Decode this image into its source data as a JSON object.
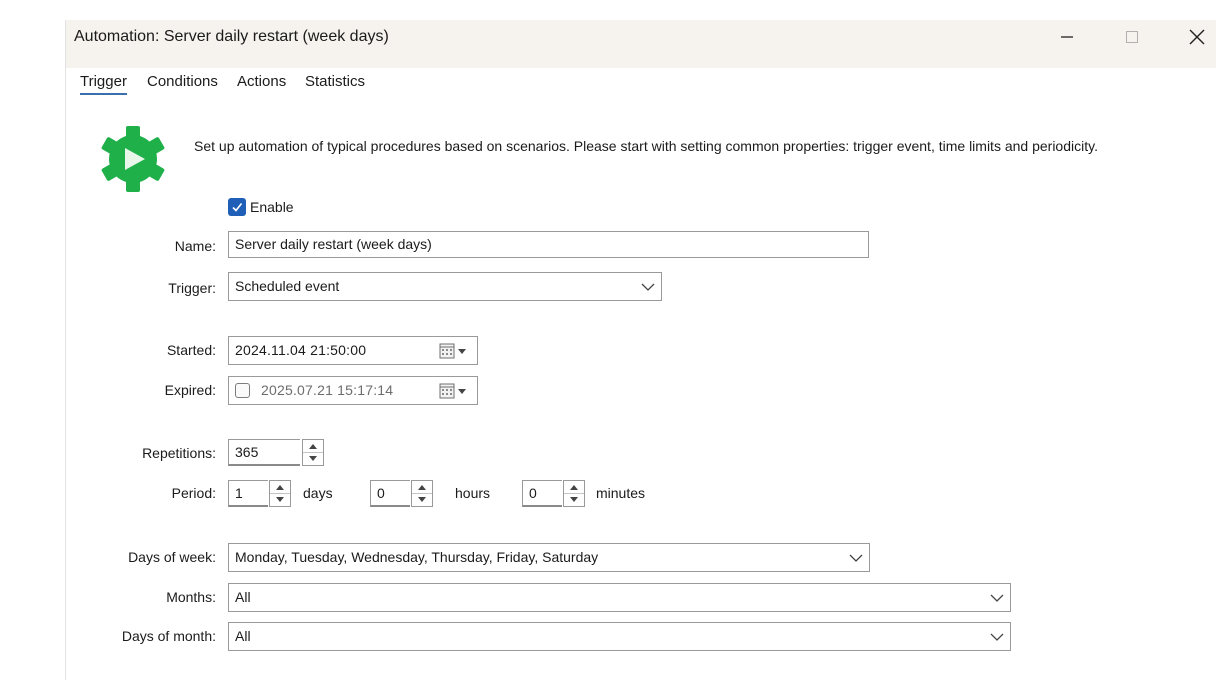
{
  "window": {
    "title": "Automation: Server daily restart (week days)"
  },
  "tabs": [
    {
      "label": "Trigger",
      "active": true
    },
    {
      "label": "Conditions",
      "active": false
    },
    {
      "label": "Actions",
      "active": false
    },
    {
      "label": "Statistics",
      "active": false
    }
  ],
  "intro": {
    "icon": "gear-play-icon",
    "description": "Set up automation of typical procedures based on scenarios. Please start with setting common properties: trigger event, time limits and periodicity."
  },
  "form": {
    "enable": {
      "label": "Enable",
      "checked": true
    },
    "name": {
      "label": "Name:",
      "value": "Server daily restart (week days)"
    },
    "trigger": {
      "label": "Trigger:",
      "value": "Scheduled event"
    },
    "started": {
      "label": "Started:",
      "value": "2024.11.04 21:50:00"
    },
    "expired": {
      "label": "Expired:",
      "value": "2025.07.21 15:17:14",
      "checked": false
    },
    "repetitions": {
      "label": "Repetitions:",
      "value": "365"
    },
    "period": {
      "label": "Period:",
      "days_value": "1",
      "days_unit": "days",
      "hours_value": "0",
      "hours_unit": "hours",
      "minutes_value": "0",
      "minutes_unit": "minutes"
    },
    "days_of_week": {
      "label": "Days of week:",
      "value": "Monday, Tuesday, Wednesday, Thursday, Friday, Saturday"
    },
    "months": {
      "label": "Months:",
      "value": "All"
    },
    "days_of_month": {
      "label": "Days of month:",
      "value": "All"
    }
  },
  "colors": {
    "titlebar": "#f6f2ee",
    "accent": "#1f5fb8",
    "gear": "#1fb04a"
  }
}
